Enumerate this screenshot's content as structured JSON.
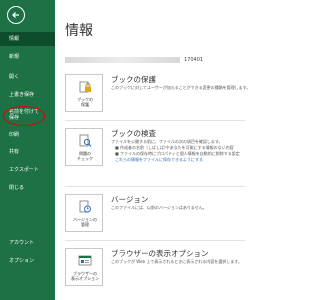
{
  "sidebar": {
    "items": [
      {
        "label": "情報"
      },
      {
        "label": "新規"
      },
      {
        "label": "開く"
      },
      {
        "label": "上書き保存"
      },
      {
        "label": "名前を付けて保存"
      },
      {
        "label": "印刷"
      },
      {
        "label": "共有"
      },
      {
        "label": "エクスポート"
      },
      {
        "label": "閉じる"
      },
      {
        "label": "アカウント"
      },
      {
        "label": "オプション"
      }
    ]
  },
  "main": {
    "title": "情報",
    "path_suffix": "170401",
    "sections": [
      {
        "title": "ブックの保護",
        "button_label_1": "ブックの",
        "button_label_2": "保護",
        "description": "このブックに対してユーザーが加えることができる変更の種類を管理します。"
      },
      {
        "title": "ブックの検査",
        "button_label_1": "問題の",
        "button_label_2": "チェック",
        "description": "ファイルを公開する前に、ファイルの次の項目を確認します。",
        "bullets": [
          "■ 作成者の名前（しばしば)やあなたを可能にする情報のない内容",
          "■ ファイルの保存時にプロパティと個人情報を自動的に削除する設定"
        ],
        "link": "これらの情報をファイルに保存できるようにする"
      },
      {
        "title": "バージョン",
        "button_label_1": "バージョンの",
        "button_label_2": "管理",
        "description": "このファイルには、以前のバージョンはありません。"
      },
      {
        "title": "ブラウザーの表示オプション",
        "button_label_1": "ブラウザーの",
        "button_label_2": "表示オプション",
        "description": "このブックが Web 上で表示されるときに表示される内容を選択します。"
      }
    ]
  },
  "colors": {
    "sidebar": "#1e7145",
    "active": "#0e4d2c",
    "highlight": "#e00000"
  }
}
